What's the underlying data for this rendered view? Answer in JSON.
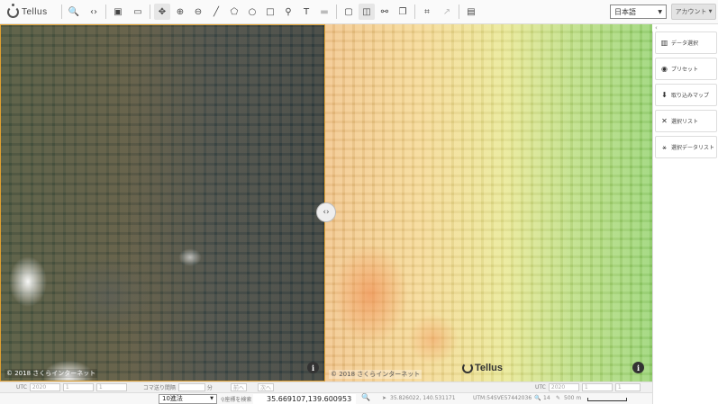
{
  "app": {
    "logo_text": "Tellus"
  },
  "toolbar": {
    "tools": [
      {
        "name": "search-icon",
        "glyph": "🔍"
      },
      {
        "name": "share-icon",
        "glyph": "‹›"
      },
      {
        "name": "camera-icon",
        "glyph": "▣"
      },
      {
        "name": "image-icon",
        "glyph": "▭"
      },
      {
        "name": "move-icon",
        "glyph": "✥"
      },
      {
        "name": "zoom-in-icon",
        "glyph": "⊕"
      },
      {
        "name": "zoom-out-icon",
        "glyph": "⊖"
      },
      {
        "name": "line-icon",
        "glyph": "╱"
      },
      {
        "name": "polygon-icon",
        "glyph": "⬠"
      },
      {
        "name": "circle-icon",
        "glyph": "○"
      },
      {
        "name": "rectangle-icon",
        "glyph": "□"
      },
      {
        "name": "pin-icon",
        "glyph": "⚲"
      },
      {
        "name": "text-icon",
        "glyph": "T"
      },
      {
        "name": "trash-icon",
        "glyph": "▬"
      },
      {
        "name": "single-view-icon",
        "glyph": "▢"
      },
      {
        "name": "split-view-icon",
        "glyph": "◫"
      },
      {
        "name": "link-icon",
        "glyph": "⚯"
      },
      {
        "name": "layers-icon",
        "glyph": "❐"
      },
      {
        "name": "crop-icon",
        "glyph": "⌗"
      },
      {
        "name": "export-icon",
        "glyph": "↗"
      },
      {
        "name": "save-icon",
        "glyph": "▤"
      }
    ],
    "language": "日本語",
    "account": "アカウント"
  },
  "map": {
    "left_copyright": "© 2018 さくらインターネット",
    "right_copyright": "© 2018 さくらインターネット",
    "watermark": "Tellus",
    "info_glyph": "i",
    "swipe_glyph": "‹›"
  },
  "sidebar": {
    "collapse": "‹",
    "items": [
      {
        "icon": "database-icon",
        "glyph": "▥",
        "label": "データ選択"
      },
      {
        "icon": "palette-icon",
        "glyph": "◉",
        "label": "プリセット"
      },
      {
        "icon": "import-map-icon",
        "glyph": "⬇",
        "label": "取り込みマップ"
      },
      {
        "icon": "tools-icon",
        "glyph": "✕",
        "label": "選択リスト"
      },
      {
        "icon": "data-list-icon",
        "glyph": "⚹",
        "label": "選択データリスト"
      }
    ]
  },
  "timebar": {
    "left_utc": "UTC",
    "left_year": "2020",
    "left_month": "1",
    "left_day": "1",
    "step_label": "コマ送り間隔",
    "step_value": "",
    "unit": "分",
    "prev": "前へ",
    "next": "次へ",
    "right_utc": "UTC",
    "right_year": "2020",
    "right_month": "1",
    "right_day": "1"
  },
  "statusbar": {
    "notation": "10進法",
    "coord_label": "座標を検索",
    "coordinates": "35.669107,139.600953",
    "cursor": "35.826022, 140.531171",
    "utm": "UTM:54SVE57442036",
    "zoom": "14",
    "scale": "500 m"
  }
}
